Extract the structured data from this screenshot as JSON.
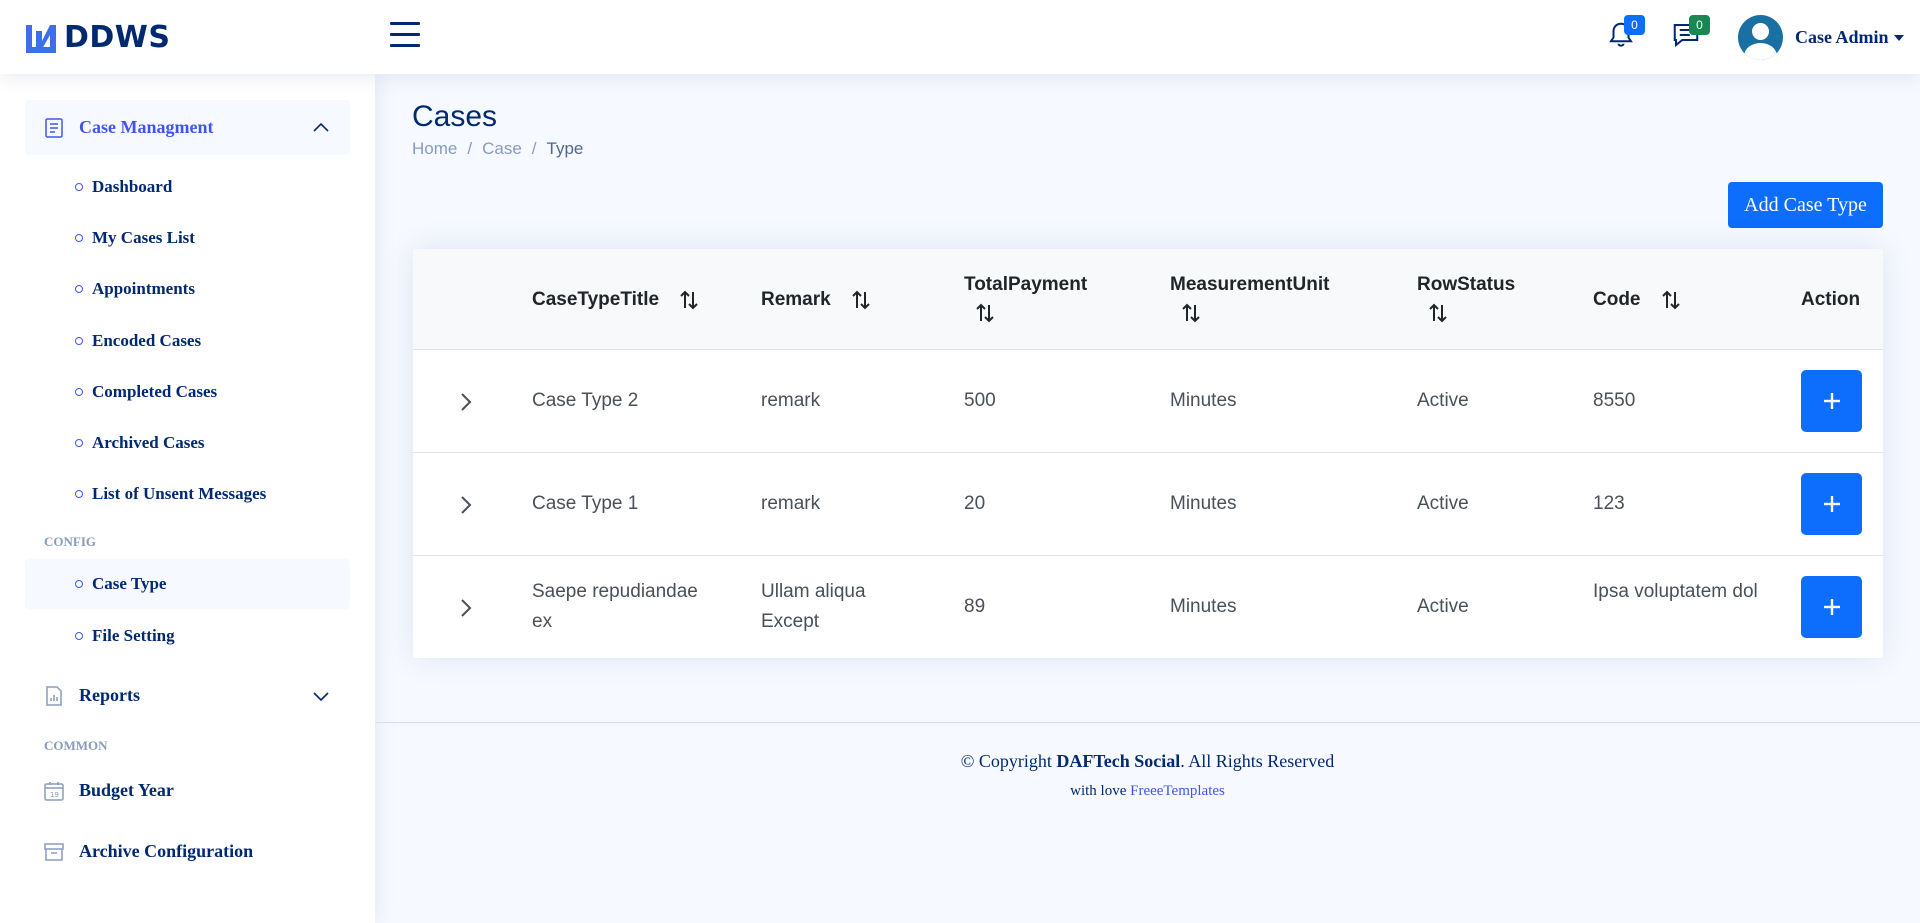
{
  "header": {
    "logo_text": "DDWS",
    "notifications_count": "0",
    "messages_count": "0",
    "profile_name": "Case Admin"
  },
  "sidebar": {
    "case_management": {
      "label": "Case Managment",
      "expanded": true
    },
    "case_items": [
      {
        "label": "Dashboard"
      },
      {
        "label": "My Cases List"
      },
      {
        "label": "Appointments"
      },
      {
        "label": "Encoded Cases"
      },
      {
        "label": "Completed Cases"
      },
      {
        "label": "Archived Cases"
      },
      {
        "label": "List of Unsent Messages"
      }
    ],
    "config_heading": "CONFIG",
    "config_items": [
      {
        "label": "Case Type",
        "active": true
      },
      {
        "label": "File Setting"
      }
    ],
    "reports": {
      "label": "Reports",
      "expanded": false
    },
    "common_heading": "COMMON",
    "budget_year": {
      "label": "Budget Year"
    },
    "archive_configuration": {
      "label": "Archive Configuration"
    }
  },
  "main": {
    "title": "Cases",
    "breadcrumb": [
      "Home",
      "Case",
      "Type"
    ],
    "add_button": "Add Case Type",
    "table": {
      "columns": [
        "CaseTypeTitle",
        "Remark",
        "TotalPayment",
        "MeasurementUnit",
        "RowStatus",
        "Code",
        "Action"
      ],
      "rows": [
        {
          "title": "Case Type 2",
          "remark": "remark",
          "total_payment": "500",
          "unit": "Minutes",
          "status": "Active",
          "code": "8550"
        },
        {
          "title": "Case Type 1",
          "remark": "remark",
          "total_payment": "20",
          "unit": "Minutes",
          "status": "Active",
          "code": "123"
        },
        {
          "title": "Saepe repudiandae ex",
          "remark": "Ullam aliqua Except",
          "total_payment": "89",
          "unit": "Minutes",
          "status": "Active",
          "code": "Ipsa voluptatem dol"
        }
      ]
    }
  },
  "footer": {
    "copyright_prefix": "© Copyright ",
    "brand": "DAFTech Social",
    "copyright_suffix": ". All Rights Reserved",
    "credits_prefix": "with love ",
    "credits_link": "FreeeTemplates"
  },
  "colors": {
    "primary": "#0d6efd",
    "accent": "#4154f1",
    "navy": "#012970",
    "success": "#198754"
  }
}
